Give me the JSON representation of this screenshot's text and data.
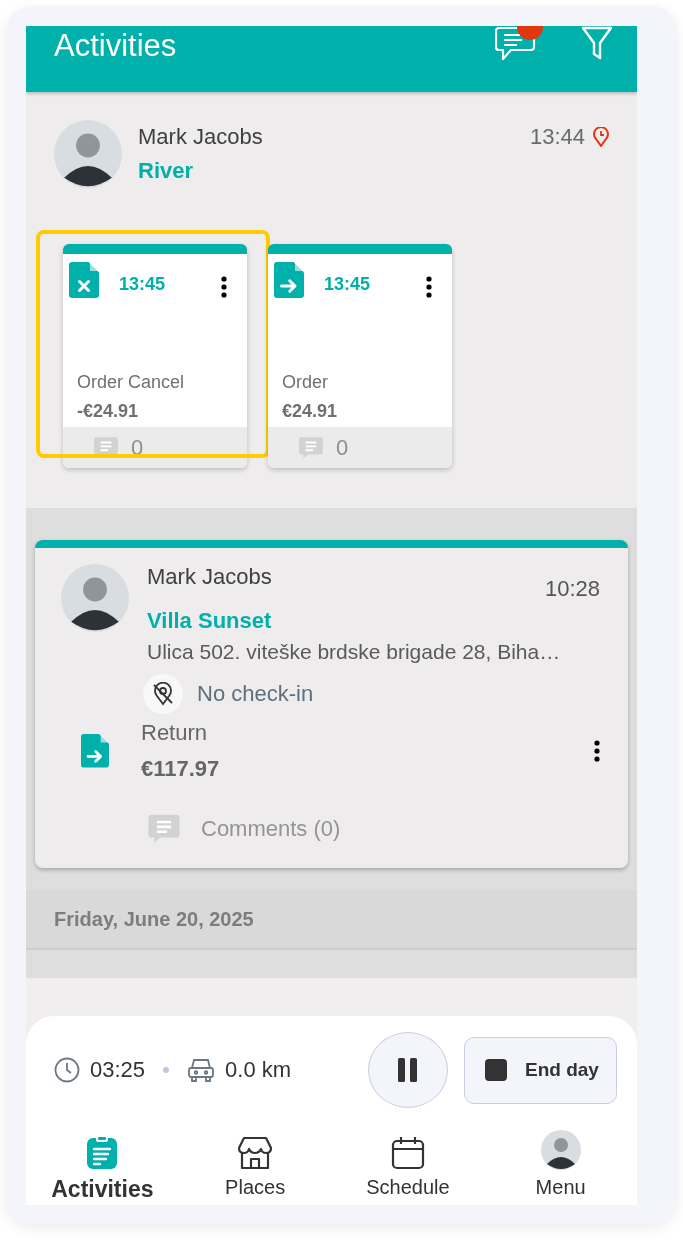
{
  "header": {
    "title": "Activities",
    "notification": true
  },
  "visit": {
    "name": "Mark Jacobs",
    "place": "River",
    "time": "13:44",
    "documents": [
      {
        "kind": "cancel",
        "time": "13:45",
        "type": "Order Cancel",
        "amount": "-€24.91",
        "comments": "0",
        "highlighted": true
      },
      {
        "kind": "forward",
        "time": "13:45",
        "type": "Order",
        "amount": "€24.91",
        "comments": "0",
        "highlighted": false
      }
    ]
  },
  "activity": {
    "name": "Mark Jacobs",
    "place": "Villa Sunset",
    "time": "10:28",
    "address": "Ulica 502. viteške brdske brigade 28, Biha…",
    "checkin": "No check-in",
    "document": {
      "kind": "forward",
      "type": "Return",
      "amount": "€117.97"
    },
    "comments": "Comments (0)"
  },
  "date_header": "Friday, June 20, 2025",
  "tracker": {
    "duration": "03:25",
    "distance": "0.0 km",
    "end_label": "End day"
  },
  "nav": [
    {
      "label": "Activities",
      "kind": "clipboard",
      "selected": true
    },
    {
      "label": "Places",
      "kind": "store",
      "selected": false
    },
    {
      "label": "Schedule",
      "kind": "calendar",
      "selected": false
    },
    {
      "label": "Menu",
      "kind": "avatar",
      "selected": false
    }
  ]
}
